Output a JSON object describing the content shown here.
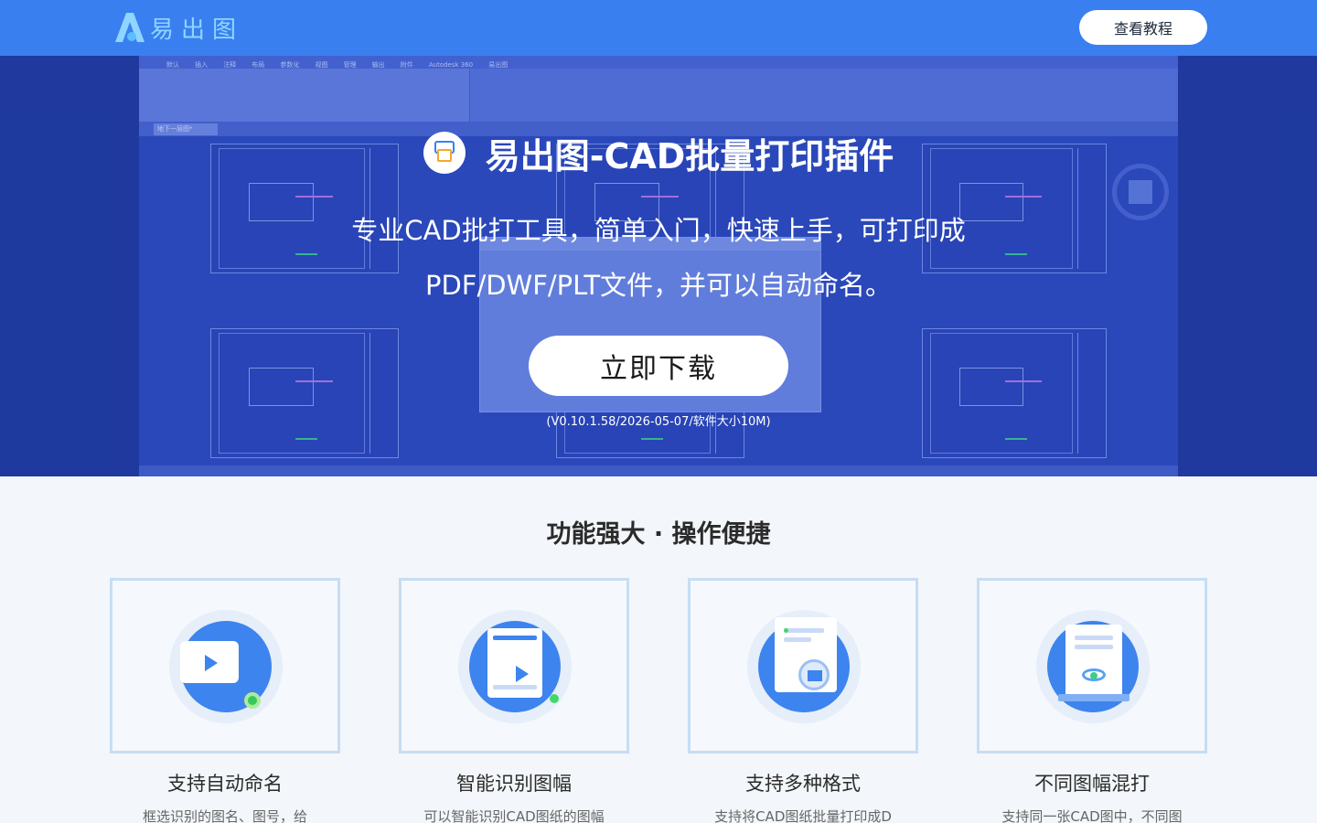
{
  "header": {
    "logo_text": "易出图",
    "tutorial_label": "查看教程"
  },
  "hero": {
    "title": "易出图-CAD批量打印插件",
    "subtitle_line1": "专业CAD批打工具，简单入门，快速上手，可打印成",
    "subtitle_line2": "PDF/DWF/PLT文件，并可以自动命名。",
    "download_label": "立即下载",
    "version": "(V0.10.1.58/2026-05-07/软件大小10M)"
  },
  "cad_preview": {
    "ribbon_tabs": [
      "默认",
      "插入",
      "注释",
      "布局",
      "参数化",
      "视图",
      "管理",
      "输出",
      "附件",
      "Autodesk 360",
      "易出图"
    ],
    "doc_tab": "地下一层图*"
  },
  "features": {
    "title": "功能强大 · 操作便捷",
    "cards": [
      {
        "title": "支持自动命名",
        "desc": "框选识别的图名、图号，给"
      },
      {
        "title": "智能识别图幅",
        "desc": "可以智能识别CAD图纸的图幅"
      },
      {
        "title": "支持多种格式",
        "desc": "支持将CAD图纸批量打印成D"
      },
      {
        "title": "不同图幅混打",
        "desc": "支持同一张CAD图中，不同图"
      }
    ]
  },
  "colors": {
    "header_bg": "#3a7ff0",
    "hero_bg": "#1f3a9e",
    "accent": "#3d84ee",
    "card_border": "#c7ddf3"
  }
}
